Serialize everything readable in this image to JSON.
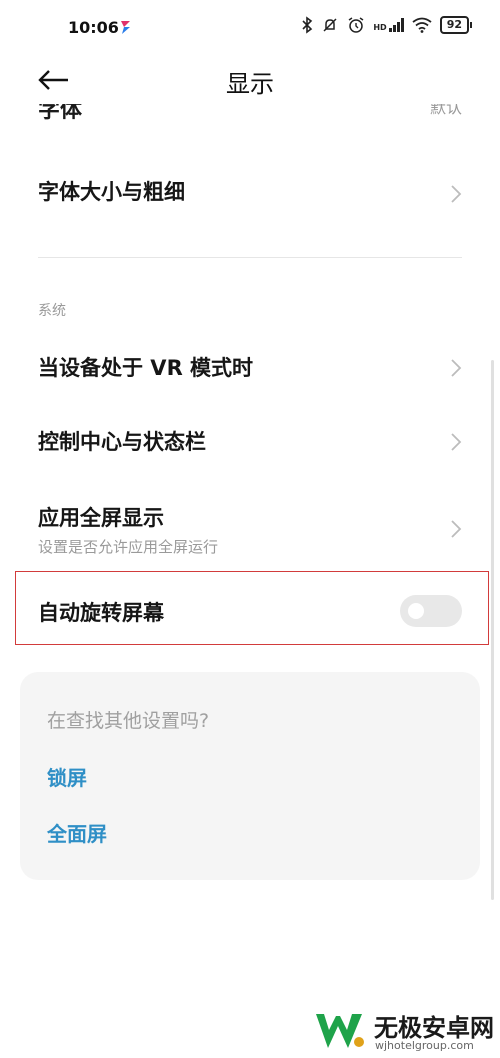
{
  "status_bar": {
    "time": "10:06",
    "icons": [
      "bluetooth-icon",
      "mute-icon",
      "alarm-icon",
      "hd-signal-icon",
      "wifi-icon",
      "battery-icon"
    ],
    "hd_label": "HD",
    "battery": "92"
  },
  "header": {
    "title": "显示"
  },
  "rows": {
    "font": {
      "label": "字体",
      "value": "默认"
    },
    "font_size": {
      "label": "字体大小与粗细"
    },
    "system_section": "系统",
    "vr_mode": {
      "label": "当设备处于 VR 模式时"
    },
    "control_center": {
      "label": "控制中心与状态栏"
    },
    "fullscreen_apps": {
      "label": "应用全屏显示",
      "sub": "设置是否允许应用全屏运行"
    },
    "auto_rotate": {
      "label": "自动旋转屏幕",
      "enabled": false
    }
  },
  "suggestions": {
    "title": "在查找其他设置吗?",
    "links": [
      "锁屏",
      "全面屏"
    ]
  },
  "watermark": {
    "title": "无极安卓网",
    "url": "wjhotelgroup.com"
  },
  "colors": {
    "link": "#2f8fc6",
    "highlight_border": "#d23b3b",
    "toggle_off": "#e8e8e8",
    "card_bg": "#f5f5f5"
  }
}
